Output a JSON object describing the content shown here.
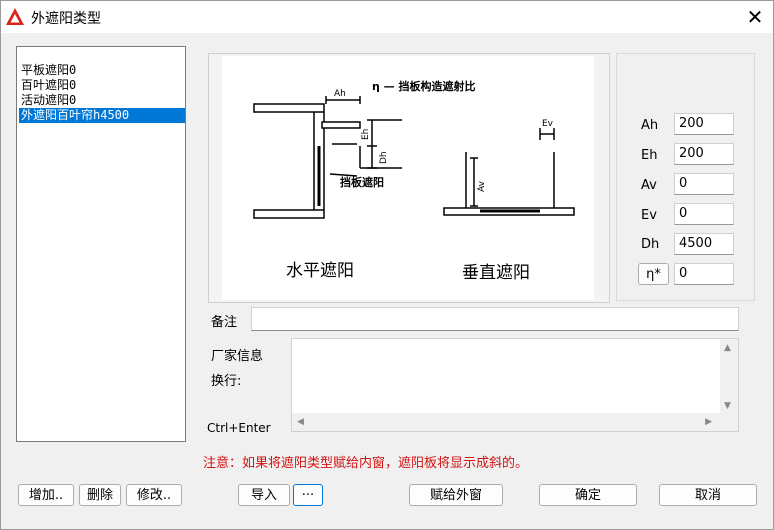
{
  "window": {
    "title": "外遮阳类型"
  },
  "list": {
    "items": [
      "平板遮阳0",
      "百叶遮阳0",
      "活动遮阳0",
      "外遮阳百叶帘h4500"
    ],
    "selected_index": 3
  },
  "diagram": {
    "eta_caption": "η — 挡板构造遮射比",
    "horizontal_title": "水平遮阳",
    "vertical_title": "垂直遮阳",
    "baffle_label": "挡板遮阳",
    "dim_ah": "Ah",
    "dim_eh": "Eh",
    "dim_dh": "Dh",
    "dim_ev": "Ev",
    "dim_av": "Av"
  },
  "params": [
    {
      "label": "Ah",
      "value": "200"
    },
    {
      "label": "Eh",
      "value": "200"
    },
    {
      "label": "Av",
      "value": "0"
    },
    {
      "label": "Ev",
      "value": "0"
    },
    {
      "label": "Dh",
      "value": "4500"
    }
  ],
  "eta": {
    "button_label": "η*",
    "value": "0"
  },
  "remark": {
    "label": "备注",
    "value": ""
  },
  "vendor": {
    "label": "厂家信息",
    "wrap_label": "换行:",
    "hint": "Ctrl+Enter",
    "value": ""
  },
  "note": "注意：如果将遮阳类型赋给内窗，遮阳板将显示成斜的。",
  "buttons": {
    "add": "增加..",
    "delete": "删除",
    "modify": "修改..",
    "import": "导入",
    "more": "···",
    "assign": "赋给外窗",
    "ok": "确定",
    "cancel": "取消"
  },
  "colors": {
    "selection": "#0078d7",
    "note": "#d41212",
    "focus": "#0078d7"
  }
}
